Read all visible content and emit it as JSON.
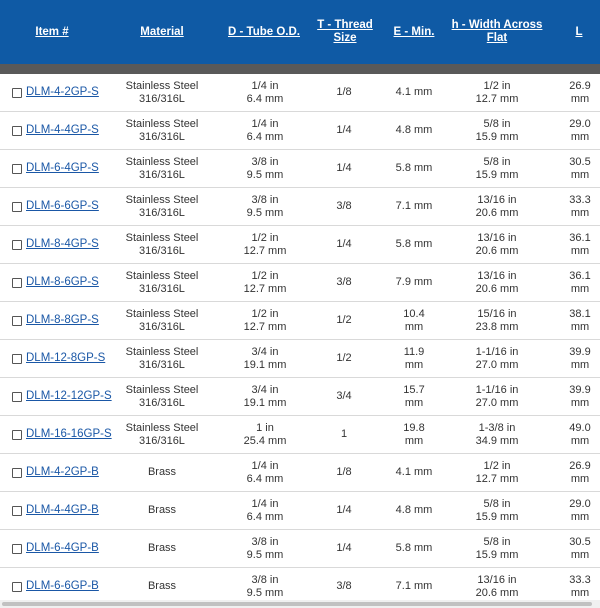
{
  "table": {
    "headers": {
      "item": "Item #",
      "material": "Material",
      "d": "D - Tube O.D.",
      "t": "T - Thread Size",
      "e": "E - Min.",
      "h": "h - Width Across Flat",
      "l": "L"
    },
    "colors": {
      "header_bg": "#0f5aa5",
      "link": "#1a57a6",
      "separator": "#595959"
    },
    "rows": [
      {
        "item": "DLM-4-2GP-S",
        "material": "Stainless Steel 316/316L",
        "d_in": "1/4 in",
        "d_mm": "6.4 mm",
        "t": "1/8",
        "e": "4.1 mm",
        "h_in": "1/2 in",
        "h_mm": "12.7 mm",
        "l_val": "26.9",
        "l_unit": "mm"
      },
      {
        "item": "DLM-4-4GP-S",
        "material": "Stainless Steel 316/316L",
        "d_in": "1/4 in",
        "d_mm": "6.4 mm",
        "t": "1/4",
        "e": "4.8 mm",
        "h_in": "5/8 in",
        "h_mm": "15.9 mm",
        "l_val": "29.0",
        "l_unit": "mm"
      },
      {
        "item": "DLM-6-4GP-S",
        "material": "Stainless Steel 316/316L",
        "d_in": "3/8 in",
        "d_mm": "9.5 mm",
        "t": "1/4",
        "e": "5.8 mm",
        "h_in": "5/8 in",
        "h_mm": "15.9 mm",
        "l_val": "30.5",
        "l_unit": "mm"
      },
      {
        "item": "DLM-6-6GP-S",
        "material": "Stainless Steel 316/316L",
        "d_in": "3/8 in",
        "d_mm": "9.5 mm",
        "t": "3/8",
        "e": "7.1 mm",
        "h_in": "13/16 in",
        "h_mm": "20.6 mm",
        "l_val": "33.3",
        "l_unit": "mm"
      },
      {
        "item": "DLM-8-4GP-S",
        "material": "Stainless Steel 316/316L",
        "d_in": "1/2 in",
        "d_mm": "12.7 mm",
        "t": "1/4",
        "e": "5.8 mm",
        "h_in": "13/16 in",
        "h_mm": "20.6 mm",
        "l_val": "36.1",
        "l_unit": "mm"
      },
      {
        "item": "DLM-8-6GP-S",
        "material": "Stainless Steel 316/316L",
        "d_in": "1/2 in",
        "d_mm": "12.7 mm",
        "t": "3/8",
        "e": "7.9 mm",
        "h_in": "13/16 in",
        "h_mm": "20.6 mm",
        "l_val": "36.1",
        "l_unit": "mm"
      },
      {
        "item": "DLM-8-8GP-S",
        "material": "Stainless Steel 316/316L",
        "d_in": "1/2 in",
        "d_mm": "12.7 mm",
        "t": "1/2",
        "e": "10.4 mm",
        "h_in": "15/16 in",
        "h_mm": "23.8 mm",
        "l_val": "38.1",
        "l_unit": "mm"
      },
      {
        "item": "DLM-12-8GP-S",
        "material": "Stainless Steel 316/316L",
        "d_in": "3/4 in",
        "d_mm": "19.1 mm",
        "t": "1/2",
        "e": "11.9 mm",
        "h_in": "1-1/16 in",
        "h_mm": "27.0 mm",
        "l_val": "39.9",
        "l_unit": "mm"
      },
      {
        "item": "DLM-12-12GP-S",
        "material": "Stainless Steel 316/316L",
        "d_in": "3/4 in",
        "d_mm": "19.1 mm",
        "t": "3/4",
        "e": "15.7 mm",
        "h_in": "1-1/16 in",
        "h_mm": "27.0 mm",
        "l_val": "39.9",
        "l_unit": "mm"
      },
      {
        "item": "DLM-16-16GP-S",
        "material": "Stainless Steel 316/316L",
        "d_in": "1 in",
        "d_mm": "25.4 mm",
        "t": "1",
        "e": "19.8 mm",
        "h_in": "1-3/8 in",
        "h_mm": "34.9 mm",
        "l_val": "49.0",
        "l_unit": "mm"
      },
      {
        "item": "DLM-4-2GP-B",
        "material": "Brass",
        "d_in": "1/4 in",
        "d_mm": "6.4 mm",
        "t": "1/8",
        "e": "4.1 mm",
        "h_in": "1/2 in",
        "h_mm": "12.7 mm",
        "l_val": "26.9",
        "l_unit": "mm"
      },
      {
        "item": "DLM-4-4GP-B",
        "material": "Brass",
        "d_in": "1/4 in",
        "d_mm": "6.4 mm",
        "t": "1/4",
        "e": "4.8 mm",
        "h_in": "5/8 in",
        "h_mm": "15.9 mm",
        "l_val": "29.0",
        "l_unit": "mm"
      },
      {
        "item": "DLM-6-4GP-B",
        "material": "Brass",
        "d_in": "3/8 in",
        "d_mm": "9.5 mm",
        "t": "1/4",
        "e": "5.8 mm",
        "h_in": "5/8 in",
        "h_mm": "15.9 mm",
        "l_val": "30.5",
        "l_unit": "mm"
      },
      {
        "item": "DLM-6-6GP-B",
        "material": "Brass",
        "d_in": "3/8 in",
        "d_mm": "9.5 mm",
        "t": "3/8",
        "e": "7.1 mm",
        "h_in": "13/16 in",
        "h_mm": "20.6 mm",
        "l_val": "33.3",
        "l_unit": "mm"
      }
    ]
  }
}
